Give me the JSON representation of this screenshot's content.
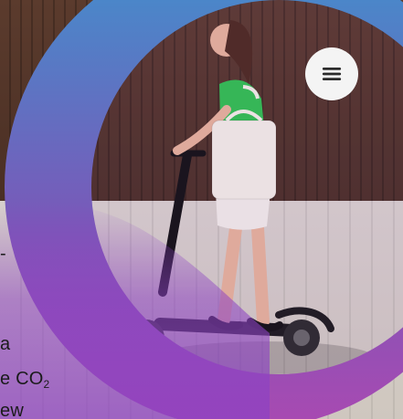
{
  "ui": {
    "menu_icon": "menu-icon"
  },
  "hero": {
    "lines": [
      "-",
      "a",
      "e CO",
      "ew"
    ],
    "co_sub": "2"
  },
  "colors": {
    "ring_top": "#4b86c9",
    "ring_bottom": "#a74ab2",
    "overlay_purple": "#8d42c3"
  }
}
